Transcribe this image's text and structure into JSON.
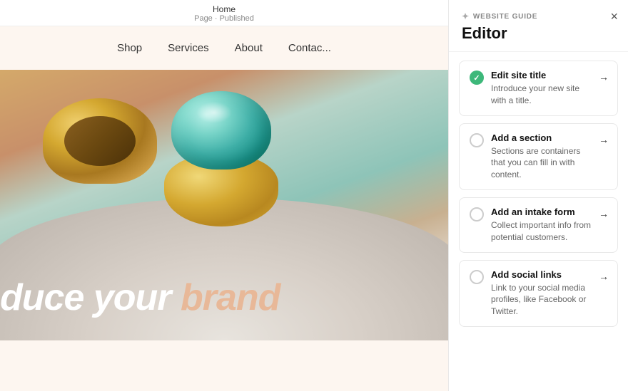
{
  "topbar": {
    "title": "Home",
    "status": "Page · Published"
  },
  "nav": {
    "items": [
      {
        "label": "Shop"
      },
      {
        "label": "Services"
      },
      {
        "label": "About"
      },
      {
        "label": "Contac..."
      }
    ]
  },
  "hero": {
    "text_white": "duce your ",
    "text_peach": "brand"
  },
  "panel": {
    "guide_label": "WEBSITE GUIDE",
    "title": "Editor",
    "close_label": "×",
    "items": [
      {
        "id": "edit-site-title",
        "completed": true,
        "title": "Edit site title",
        "description": "Introduce your new site with a title.",
        "arrow": "→"
      },
      {
        "id": "add-section",
        "completed": false,
        "title": "Add a section",
        "description": "Sections are containers that you can fill in with content.",
        "arrow": "→"
      },
      {
        "id": "add-intake-form",
        "completed": false,
        "title": "Add an intake form",
        "description": "Collect important info from potential customers.",
        "arrow": "→"
      },
      {
        "id": "add-social-links",
        "completed": false,
        "title": "Add social links",
        "description": "Link to your social media profiles, like Facebook or Twitter.",
        "arrow": "→"
      }
    ]
  }
}
